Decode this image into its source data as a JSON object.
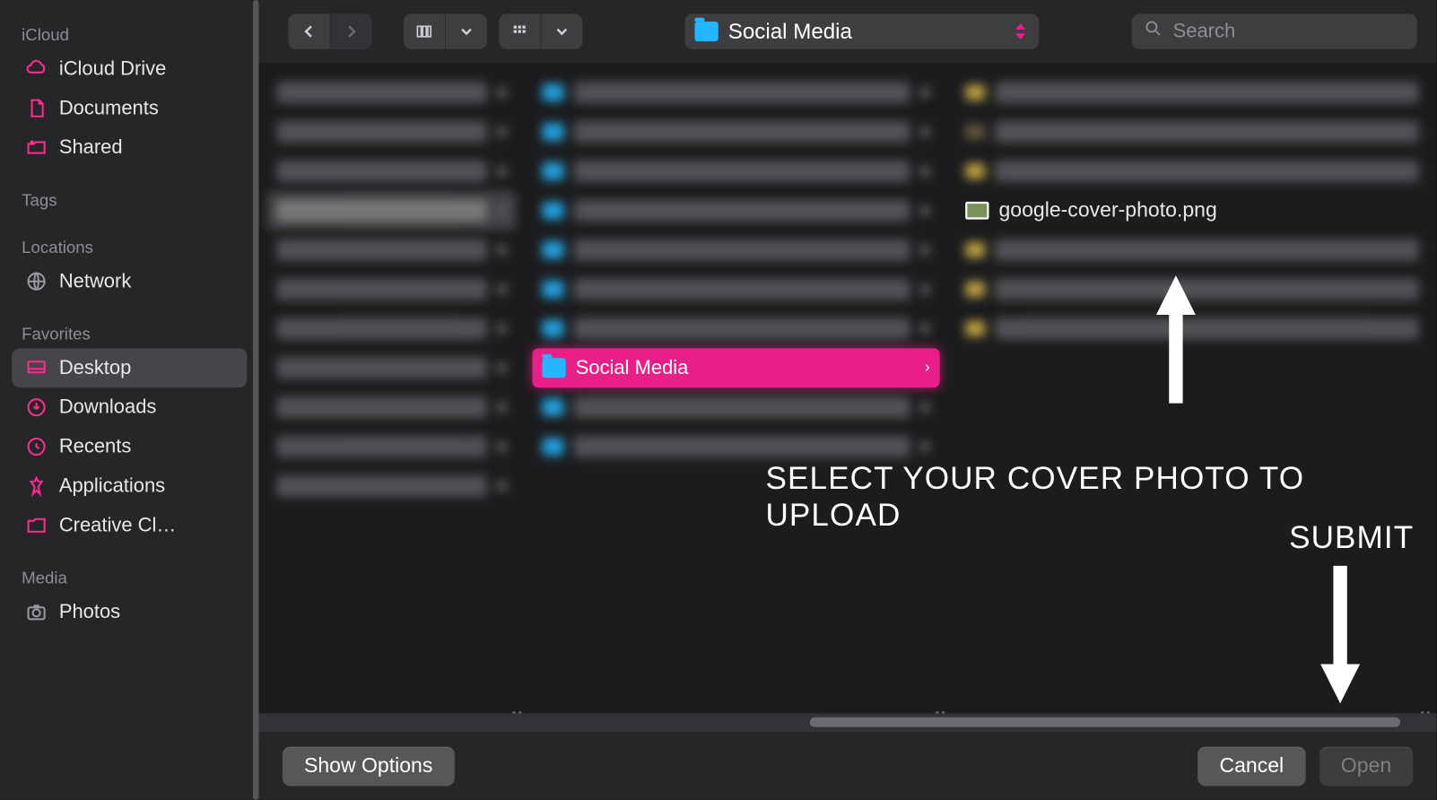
{
  "sidebar": {
    "groups": [
      {
        "label": "iCloud",
        "items": [
          {
            "icon": "cloud",
            "label": "iCloud Drive"
          },
          {
            "icon": "doc",
            "label": "Documents"
          },
          {
            "icon": "shared",
            "label": "Shared"
          }
        ]
      },
      {
        "label": "Tags",
        "items": []
      },
      {
        "label": "Locations",
        "items": [
          {
            "icon": "globe",
            "label": "Network",
            "grey": true
          }
        ]
      },
      {
        "label": "Favorites",
        "items": [
          {
            "icon": "desktop",
            "label": "Desktop",
            "selected": true
          },
          {
            "icon": "download",
            "label": "Downloads"
          },
          {
            "icon": "clock",
            "label": "Recents"
          },
          {
            "icon": "apps",
            "label": "Applications"
          },
          {
            "icon": "folder",
            "label": "Creative Cl…"
          }
        ]
      },
      {
        "label": "Media",
        "items": [
          {
            "icon": "camera",
            "label": "Photos",
            "grey": true
          }
        ]
      }
    ]
  },
  "toolbar": {
    "path_label": "Social Media",
    "search_placeholder": "Search"
  },
  "columns": {
    "col2_selected": "Social Media",
    "col3_visible_file": "google-cover-photo.png"
  },
  "footer": {
    "show_options": "Show Options",
    "cancel": "Cancel",
    "open": "Open"
  },
  "annotations": {
    "select_text": "Select your cover photo to upload",
    "submit_text": "Submit"
  }
}
